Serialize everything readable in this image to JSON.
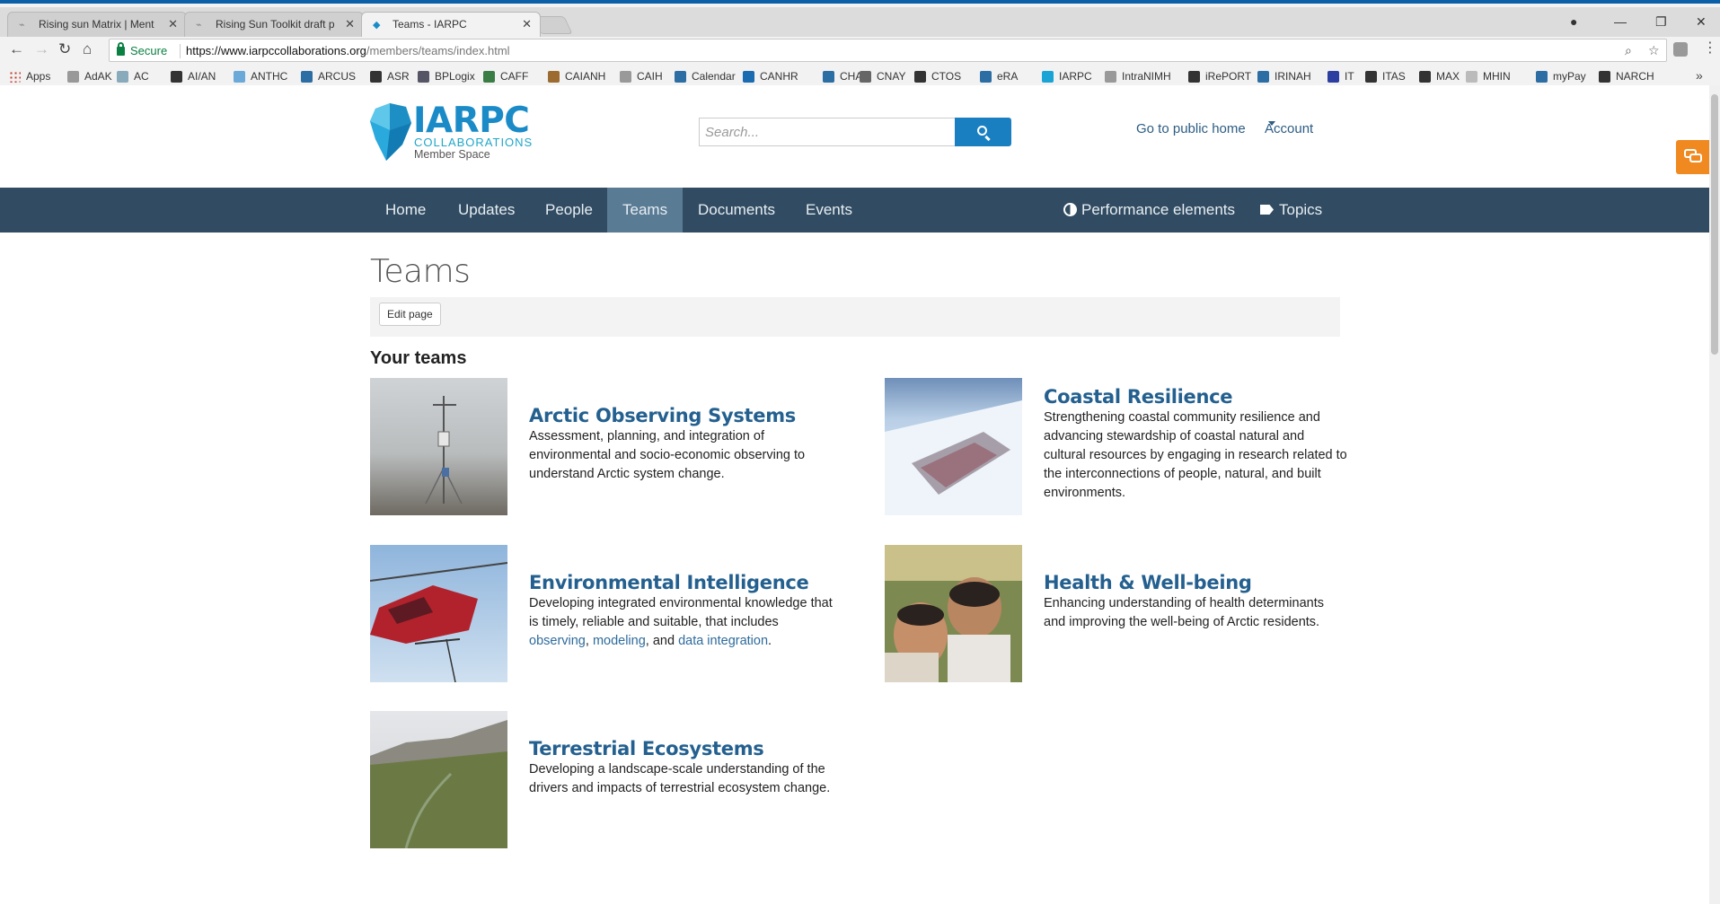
{
  "browser": {
    "tabs": [
      {
        "title": "Rising sun Matrix | Ment"
      },
      {
        "title": "Rising Sun Toolkit draft p"
      },
      {
        "title": "Teams - IARPC"
      }
    ],
    "secure_label": "Secure",
    "url_host": "https://www.iarpccollaborations.org",
    "url_path": "/members/teams/index.html",
    "bookmarks": [
      "Apps",
      "AdAK",
      "AC",
      "AI/AN",
      "ANTHC",
      "ARCUS",
      "ASR",
      "BPLogix",
      "CAFF",
      "CAIANH",
      "CAIH",
      "Calendar",
      "CANHR",
      "CHA",
      "CNAY",
      "CTOS",
      "eRA",
      "IARPC",
      "IntraNIMH",
      "iRePORT",
      "IRINAH",
      "IT",
      "ITAS",
      "MAX",
      "MHIN",
      "myPay",
      "NARCH"
    ],
    "bookmarks_more": "»"
  },
  "site": {
    "logo_name": "IARPC",
    "logo_sub": "COLLABORATIONS",
    "logo_tag": "Member Space",
    "search_placeholder": "Search...",
    "link_public_home": "Go to public home",
    "link_account": "Account"
  },
  "nav": {
    "items": [
      "Home",
      "Updates",
      "People",
      "Teams",
      "Documents",
      "Events"
    ],
    "active": "Teams",
    "right_items": [
      "Performance elements",
      "Topics"
    ]
  },
  "content": {
    "page_title": "Teams",
    "edit_button": "Edit page",
    "section_title": "Your teams",
    "teams": [
      {
        "name": "Arctic Observing Systems",
        "desc": "Assessment, planning, and integration of environmental and socio-economic observing to understand Arctic system change."
      },
      {
        "name": "Coastal Resilience",
        "desc": "Strengthening coastal community resilience and advancing stewardship of coastal natural and cultural resources by engaging in research related to the interconnections of people, natural, and built environments."
      },
      {
        "name": "Environmental Intelligence",
        "desc_pre": "Developing integrated environmental knowledge that is timely, reliable and suitable, that includes ",
        "link1": "observing",
        "sep1": ", ",
        "link2": "modeling",
        "sep2": ", and ",
        "link3": "data integration",
        "desc_post": "."
      },
      {
        "name": "Health & Well-being",
        "desc": "Enhancing understanding of health determinants and improving the well-being of Arctic residents."
      },
      {
        "name": "Terrestrial Ecosystems",
        "desc": "Developing a landscape-scale understanding of the drivers and impacts of terrestrial ecosystem change."
      }
    ]
  },
  "colors": {
    "nav_bg": "#314c62",
    "nav_active": "#5a7b94",
    "link": "#24608f",
    "search_button": "#1a7fc1",
    "feedback": "#f0891f"
  }
}
